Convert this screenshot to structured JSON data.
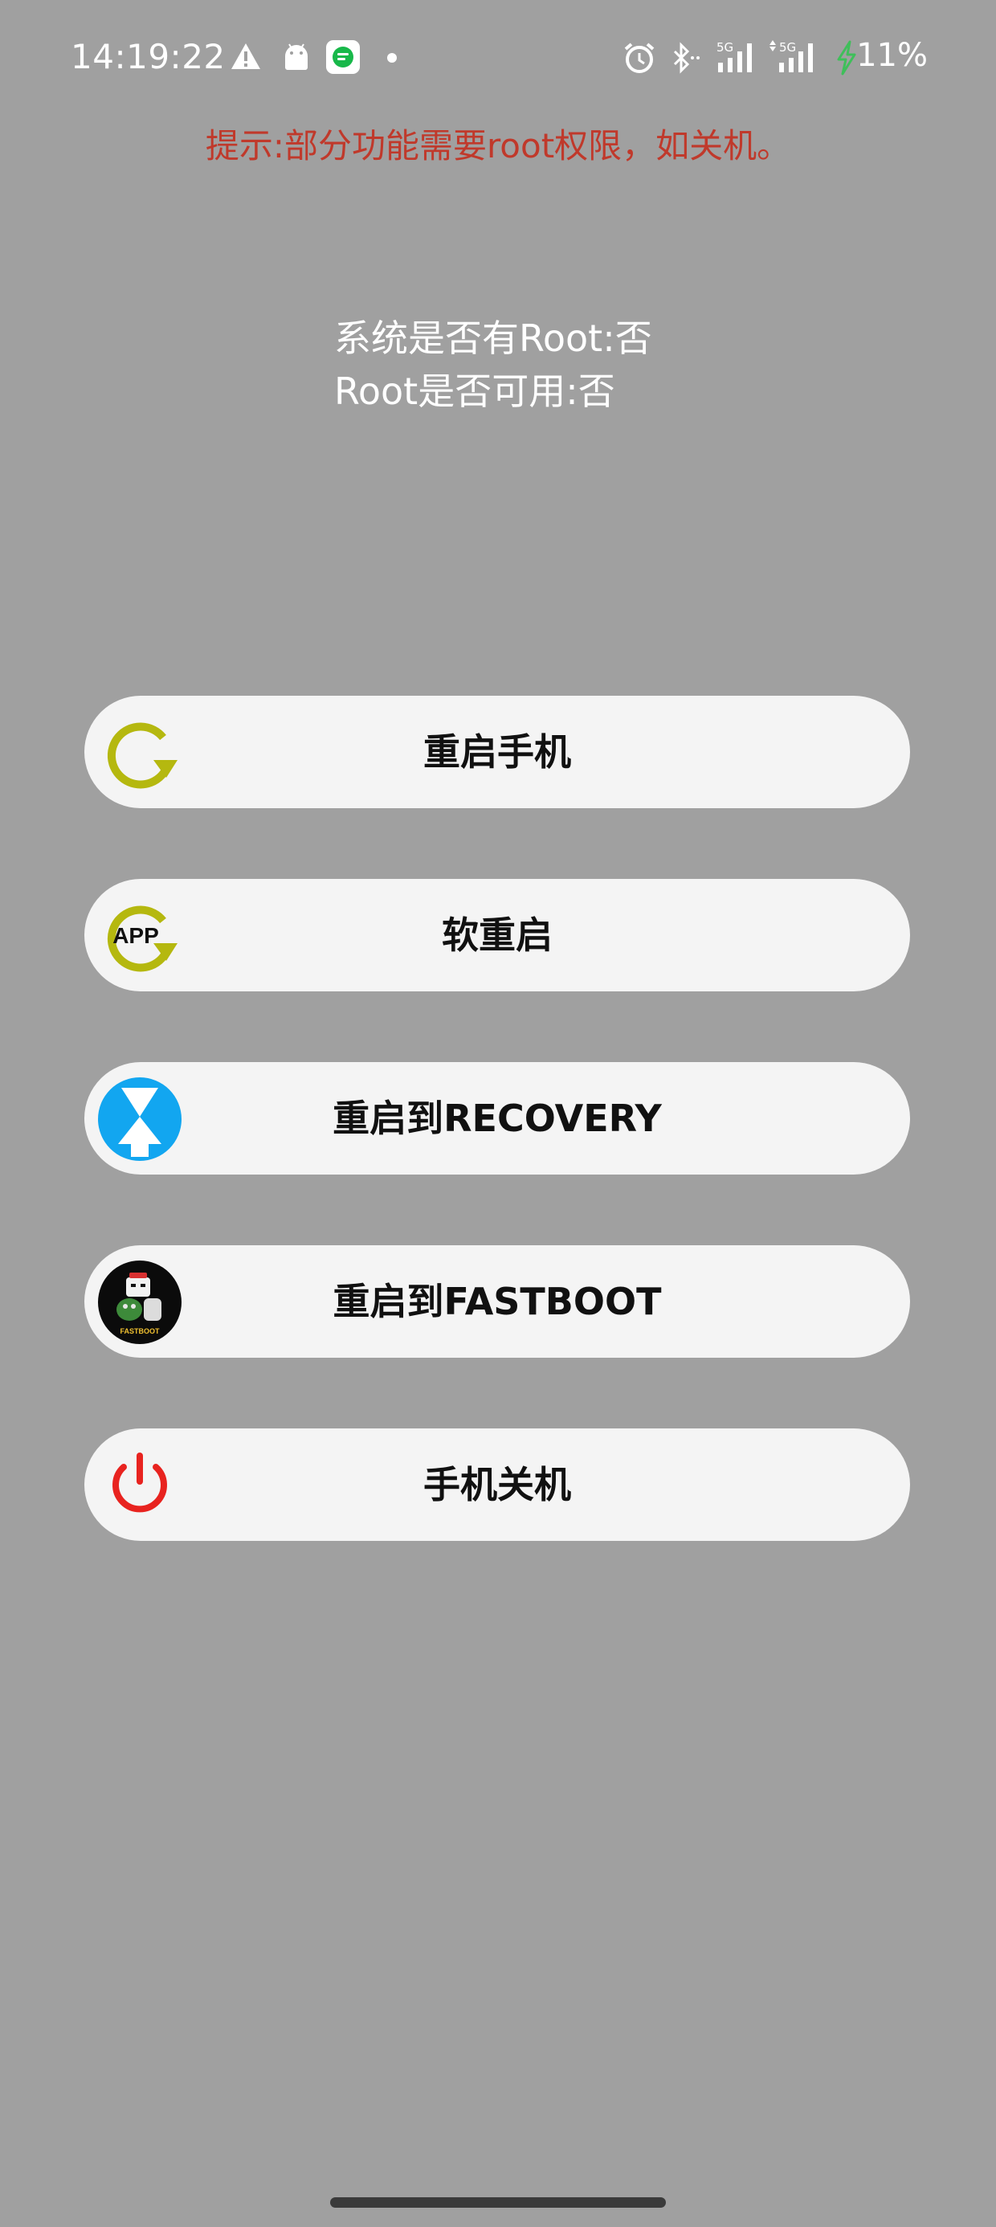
{
  "status_bar": {
    "time": "14:19:22",
    "battery": "11%",
    "left_icons": [
      "warning-icon",
      "android-icon",
      "chat-app-icon",
      "dot-icon"
    ],
    "right_icons": [
      "alarm-icon",
      "bluetooth-icon",
      "signal-5g-icon",
      "signal-5g-icon",
      "charging-icon"
    ],
    "network_label": "5G"
  },
  "tip": "提示:部分功能需要root权限，如关机。",
  "root_info": {
    "has_root": "系统是否有Root:否",
    "root_available": "Root是否可用:否"
  },
  "buttons": [
    {
      "label": "重启手机",
      "icon": "reboot-icon"
    },
    {
      "label": "软重启",
      "icon": "app-restart-icon"
    },
    {
      "label": "重启到RECOVERY",
      "icon": "recovery-icon"
    },
    {
      "label": "重启到FASTBOOT",
      "icon": "fastboot-icon"
    },
    {
      "label": "手机关机",
      "icon": "power-icon"
    }
  ],
  "icon_text": {
    "app": "APP",
    "fastboot": "FASTBOOT"
  },
  "colors": {
    "background": "#a0a0a0",
    "tip": "#c0392b",
    "button_bg": "#f4f4f4",
    "reboot_icon": "#b5b80f",
    "recovery_icon": "#12a6f0",
    "power_icon": "#e8231f",
    "charging": "#3fbf5a"
  }
}
